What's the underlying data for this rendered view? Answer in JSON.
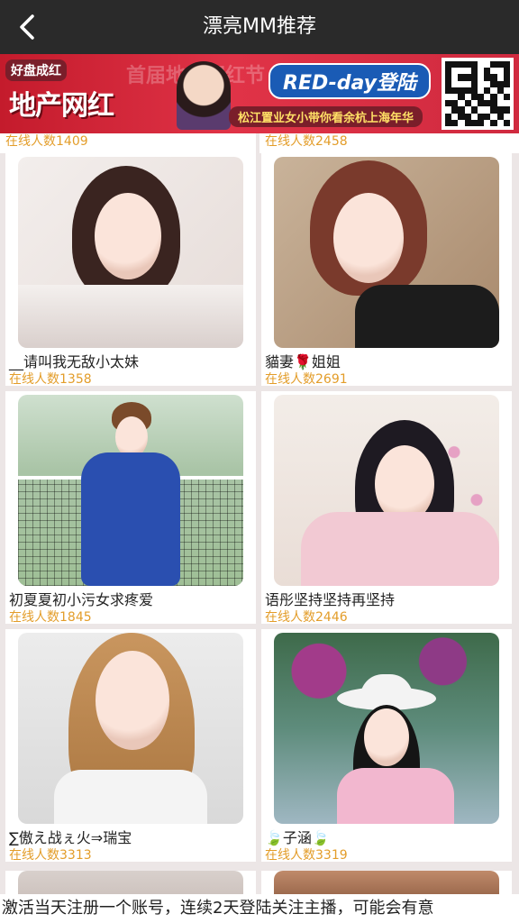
{
  "header": {
    "title": "漂亮MM推荐"
  },
  "banner": {
    "tag": "好盘成红",
    "headline": "地产网红",
    "background_text": "首届地产网红节",
    "campaign": "RED-day登陆",
    "subtitle": "松江置业女小带你看余杭上海年华"
  },
  "top_strip": [
    {
      "online": "在线人数1409"
    },
    {
      "online": "在线人数2458"
    }
  ],
  "cards": [
    {
      "name": "__请叫我无敌小太妹",
      "online": "在线人数1358"
    },
    {
      "name": "貓妻🌹姐姐",
      "online": "在线人数2691"
    },
    {
      "name": "初夏夏初小污女求疼爱",
      "online": "在线人数1845"
    },
    {
      "name": "语彤坚持坚持再坚持",
      "online": "在线人数2446"
    },
    {
      "name": "∑傲え战ぇ火⇒瑞宝",
      "online": "在线人数3313"
    },
    {
      "name": "🍃子涵🍃",
      "online": "在线人数3319"
    }
  ],
  "notice": "激活当天注册一个账号，连续2天登陆关注主播，可能会有意"
}
